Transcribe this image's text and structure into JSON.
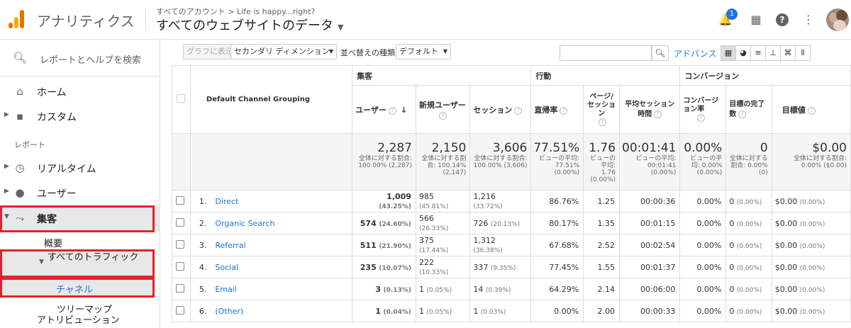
{
  "header": {
    "app_title": "アナリティクス",
    "breadcrumb": "すべてのアカウント > Life is happy...right?",
    "view_title": "すべてのウェブサイトのデータ",
    "notification_count": "1",
    "brand_colors": {
      "orange_dark": "#e37400",
      "orange_light": "#f9ab00",
      "blue": "#1a73e8"
    }
  },
  "sidebar": {
    "search_label": "レポートとヘルプを検索",
    "home": "ホーム",
    "custom": "カスタム",
    "section_reports": "レポート",
    "realtime": "リアルタイム",
    "users": "ユーザー",
    "acquisition": "集客",
    "overview": "概要",
    "all_traffic": "すべてのトラフィック",
    "channels": "チャネル",
    "treemap": "ツリーマップ",
    "attribution": "アトリビューション"
  },
  "toolbar": {
    "plot_rows": "グラフに表示",
    "secondary_dimension": "セカンダリ ディメンション",
    "sort_type_label": "並べ替えの種類:",
    "sort_type_value": "デフォルト",
    "advanced": "アドバンス"
  },
  "table": {
    "dimension_header": "Default Channel Grouping",
    "groups": {
      "acquisition": "集客",
      "behavior": "行動",
      "conversions": "コンバージョン"
    },
    "columns": {
      "users": "ユーザー",
      "new_users": "新規ユーザー",
      "sessions": "セッション",
      "bounce_rate": "直帰率",
      "pages_session": "ページ/セッション",
      "avg_session": "平均セッション時間",
      "conversion_rate": "コンバージョン率",
      "goal_completions": "目標の完了数",
      "goal_value": "目標値"
    },
    "totals": {
      "users": "2,287",
      "users_sub": "全体に対する割合: 100.00% (2,287)",
      "new_users": "2,150",
      "new_users_sub": "全体に対する割合: 100.14% (2,147)",
      "sessions": "3,606",
      "sessions_sub": "全体に対する割合: 100.00% (3,606)",
      "bounce_rate": "77.51%",
      "bounce_rate_sub": "ビューの平均: 77.51% (0.00%)",
      "pages_session": "1.76",
      "pages_session_sub": "ビューの平均: 1.76 (0.00%)",
      "avg_session": "00:01:41",
      "avg_session_sub": "ビューの平均: 00:01:41 (0.00%)",
      "conversion_rate": "0.00%",
      "conversion_rate_sub": "ビューの平均: 0.00% (0.00%)",
      "goal_completions": "0",
      "goal_completions_sub": "全体に対する割合: 0.00% (0)",
      "goal_value": "$0.00",
      "goal_value_sub": "全体に対する割合: 0.00% ($0.00)"
    },
    "rows": [
      {
        "idx": "1.",
        "name": "Direct",
        "users": "1,009",
        "users_pct": "(43.25%)",
        "new_users": "985",
        "new_users_pct": "(45.81%)",
        "sessions": "1,216",
        "sessions_pct": "(33.72%)",
        "bounce": "86.76%",
        "pages": "1.25",
        "duration": "00:00:36",
        "conv": "0.00%",
        "goals": "0",
        "goals_pct": "(0.00%)",
        "value": "$0.00",
        "value_pct": "(0.00%)"
      },
      {
        "idx": "2.",
        "name": "Organic Search",
        "users": "574",
        "users_pct": "(24.60%)",
        "new_users": "566",
        "new_users_pct": "(26.33%)",
        "sessions": "726",
        "sessions_pct": "(20.13%)",
        "bounce": "80.17%",
        "pages": "1.35",
        "duration": "00:01:15",
        "conv": "0.00%",
        "goals": "0",
        "goals_pct": "(0.00%)",
        "value": "$0.00",
        "value_pct": "(0.00%)"
      },
      {
        "idx": "3.",
        "name": "Referral",
        "users": "511",
        "users_pct": "(21.90%)",
        "new_users": "375",
        "new_users_pct": "(17.44%)",
        "sessions": "1,312",
        "sessions_pct": "(36.38%)",
        "bounce": "67.68%",
        "pages": "2.52",
        "duration": "00:02:54",
        "conv": "0.00%",
        "goals": "0",
        "goals_pct": "(0.00%)",
        "value": "$0.00",
        "value_pct": "(0.00%)"
      },
      {
        "idx": "4.",
        "name": "Social",
        "users": "235",
        "users_pct": "(10.07%)",
        "new_users": "222",
        "new_users_pct": "(10.33%)",
        "sessions": "337",
        "sessions_pct": "(9.35%)",
        "bounce": "77.45%",
        "pages": "1.55",
        "duration": "00:01:37",
        "conv": "0.00%",
        "goals": "0",
        "goals_pct": "(0.00%)",
        "value": "$0.00",
        "value_pct": "(0.00%)"
      },
      {
        "idx": "5.",
        "name": "Email",
        "users": "3",
        "users_pct": "(0.13%)",
        "new_users": "1",
        "new_users_pct": "(0.05%)",
        "sessions": "14",
        "sessions_pct": "(0.39%)",
        "bounce": "64.29%",
        "pages": "2.14",
        "duration": "00:06:00",
        "conv": "0.00%",
        "goals": "0",
        "goals_pct": "(0.00%)",
        "value": "$0.00",
        "value_pct": "(0.00%)"
      },
      {
        "idx": "6.",
        "name": "(Other)",
        "users": "1",
        "users_pct": "(0.04%)",
        "new_users": "1",
        "new_users_pct": "(0.05%)",
        "sessions": "1",
        "sessions_pct": "(0.03%)",
        "bounce": "0.00%",
        "pages": "2.00",
        "duration": "00:00:33",
        "conv": "0.00%",
        "goals": "0",
        "goals_pct": "(0.00%)",
        "value": "$0.00",
        "value_pct": "(0.00%)"
      }
    ]
  }
}
